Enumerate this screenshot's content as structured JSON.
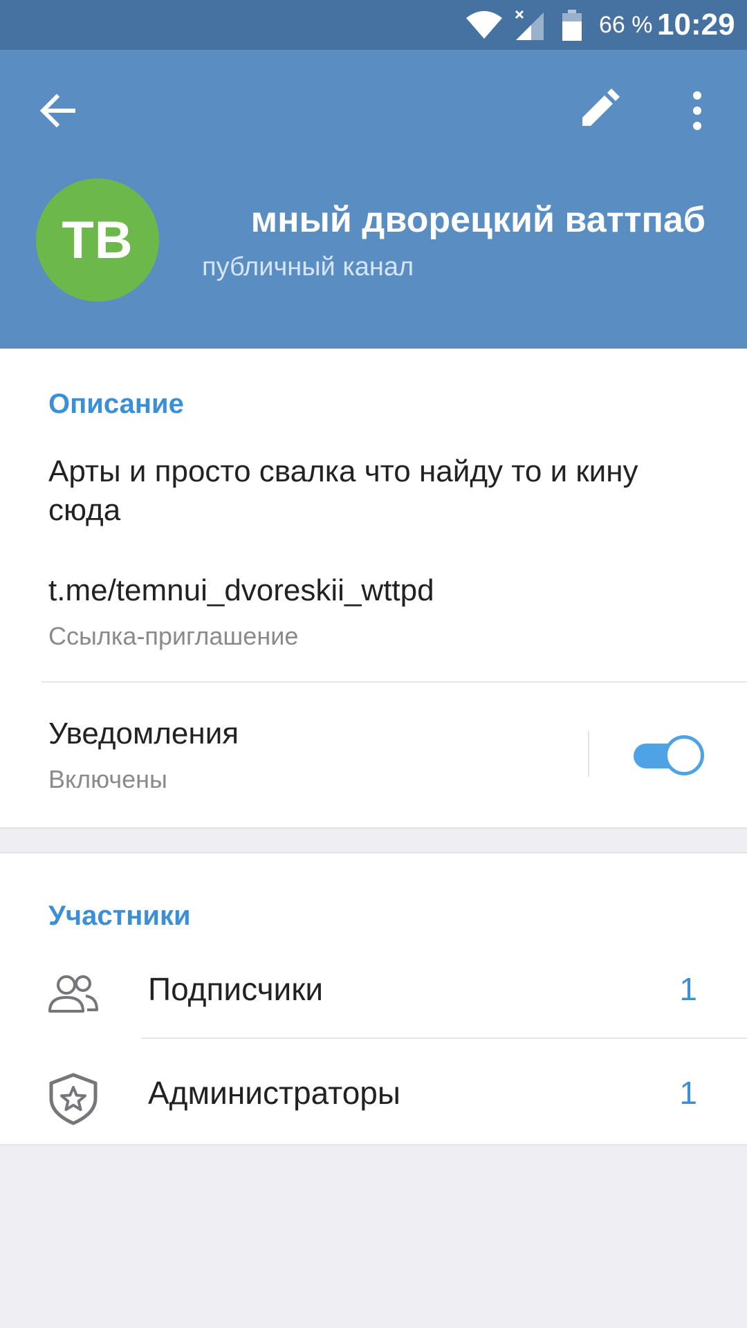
{
  "status_bar": {
    "battery_percent": "66 %",
    "time": "10:29",
    "icons": [
      "wifi-icon",
      "signal-icon",
      "battery-icon"
    ]
  },
  "header": {
    "back_icon": "arrow-left-icon",
    "edit_icon": "pencil-icon",
    "more_icon": "more-vertical-icon",
    "avatar_initials": "ТВ",
    "channel_title": "мный дворецкий ваттпаб",
    "channel_subtitle": "публичный канал",
    "colors": {
      "bar": "#5a8ec3",
      "status": "#4572a0",
      "avatar": "#6db84b"
    }
  },
  "info": {
    "section_title": "Описание",
    "description": "Арты и просто свалка что найду то и кину сюда",
    "link": "t.me/temnui_dvoreskii_wttpd",
    "link_label": "Ссылка-приглашение",
    "notifications_title": "Уведомления",
    "notifications_status": "Включены",
    "notifications_enabled": true
  },
  "members": {
    "section_title": "Участники",
    "items": [
      {
        "icon": "users-icon",
        "label": "Подписчики",
        "count": "1"
      },
      {
        "icon": "shield-star-icon",
        "label": "Администраторы",
        "count": "1"
      }
    ]
  },
  "accent_color": "#3a8fd6"
}
